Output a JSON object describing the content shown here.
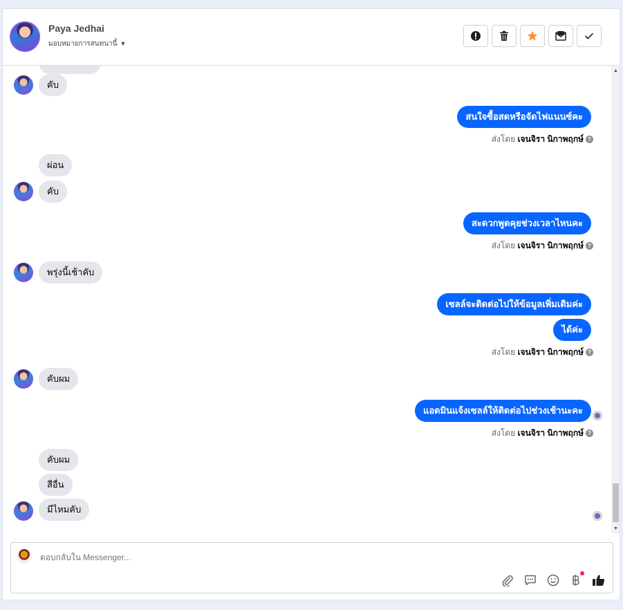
{
  "header": {
    "contact_name": "Paya Jedhai",
    "assign_text": "มอบหมายการสนทนานี้",
    "toolbar": [
      {
        "name": "spam-button",
        "icon": "exclamation-icon"
      },
      {
        "name": "delete-button",
        "icon": "trash-icon"
      },
      {
        "name": "star-button",
        "icon": "star-icon"
      },
      {
        "name": "mark-unread-button",
        "icon": "envelope-icon"
      },
      {
        "name": "done-button",
        "icon": "check-icon"
      }
    ]
  },
  "messages": {
    "m1": "คับ",
    "m2": "สนใจซื้อสดหรือจัดไฟแนนซ์คะ",
    "m3": "ผ่อน",
    "m4": "คับ",
    "m5": "สะดวกพูดคุยช่วงเวลาไหนคะ",
    "m6": "พรุ่งนี้เช้าคับ",
    "m7": "เซลล์จะติดต่อไปให้ข้อมูลเพิ่มเติมค่ะ",
    "m8": "ได้ค่ะ",
    "m9": "คับผม",
    "m10": "แอดมินแจ้งเซลล์ให้ติดต่อไปช่วงเช้านะคะ",
    "m11": "คับผม",
    "m12": "สีอื่น",
    "m13": "มีไหมคับ"
  },
  "sent_by": {
    "prefix": "ส่งโดย",
    "name": "เจนจิรา นิกาพฤกษ์",
    "help": "?"
  },
  "composer": {
    "placeholder": "ตอบกลับใน Messenger..."
  },
  "colors": {
    "outgoing_bubble": "#0866ff",
    "incoming_bubble": "#e4e6eb",
    "star_icon": "#f7923a"
  }
}
